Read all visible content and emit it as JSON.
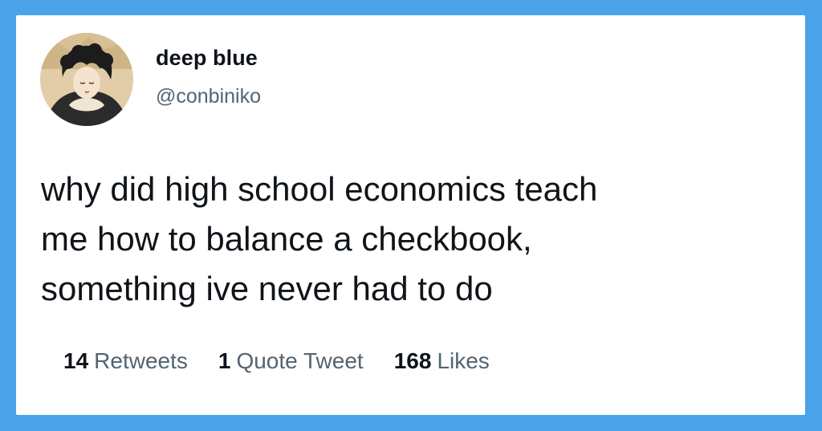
{
  "tweet": {
    "author": {
      "display_name": "deep blue",
      "handle": "@conbiniko",
      "avatar_icon": "profile-illustration"
    },
    "text": "why did high school economics teach\nme how to balance a checkbook,\nsomething ive never had to do",
    "stats": [
      {
        "count": "14",
        "label": "Retweets"
      },
      {
        "count": "1",
        "label": "Quote Tweet"
      },
      {
        "count": "168",
        "label": "Likes"
      }
    ]
  },
  "colors": {
    "border": "#4aa3e8",
    "card": "#ffffff",
    "text": "#0f1419",
    "secondary": "#536471"
  }
}
